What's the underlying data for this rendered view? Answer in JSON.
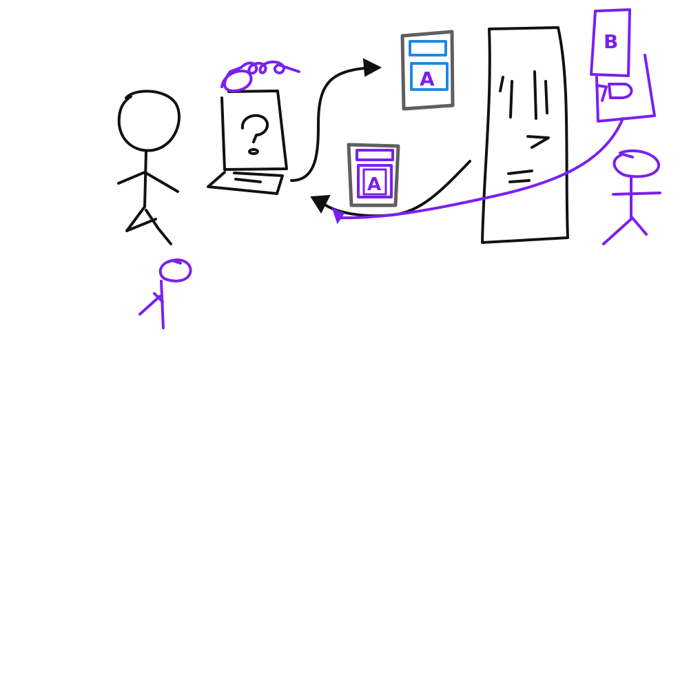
{
  "canvas": {
    "background": "#ffffff"
  },
  "colors": {
    "black_ink": "#111111",
    "purple_ink": "#7a1ff0",
    "blue_ink": "#1e88e5",
    "gray_ink": "#5f5f5f"
  },
  "labels": {
    "laptop_screen_symbol": "?",
    "doc_top_letter": "A",
    "doc_bottom_letter": "A",
    "purple_card_letter": "B"
  },
  "icons": {
    "user": "stick-figure-icon",
    "attacker": "stick-figure-icon",
    "device": "laptop-icon",
    "server": "server-tower-icon",
    "document": "document-icon",
    "tampered_document": "document-icon",
    "forged_card": "card-icon",
    "request_arrow": "arrow-icon",
    "response_arrow": "arrow-icon"
  }
}
